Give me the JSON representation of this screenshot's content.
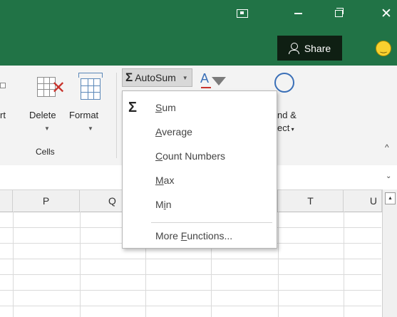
{
  "titlebar": {
    "share_label": "Share",
    "bg": "#217346"
  },
  "icons": {
    "ribbon_display": "ribbon-display-options-icon",
    "minimize": "minimize-icon",
    "restore": "restore-icon",
    "close": "close-icon",
    "share": "person-icon",
    "feedback": "smiley-icon"
  },
  "ribbon": {
    "insert_label_partial": "rt",
    "delete_label": "Delete",
    "format_label": "Format",
    "cells_group_label": "Cells",
    "autosum_label": "AutoSum",
    "find_select_line1": "nd &",
    "find_select_line2": "ect"
  },
  "autosum_menu": {
    "items": [
      {
        "label": "Sum",
        "key": "S"
      },
      {
        "label": "Average",
        "key": "A"
      },
      {
        "label": "Count Numbers",
        "key": "C"
      },
      {
        "label": "Max",
        "key": "M"
      },
      {
        "label": "Min",
        "key": "i"
      },
      {
        "label": "More Functions...",
        "key": "F"
      }
    ]
  },
  "columns": [
    "P",
    "Q",
    "",
    "",
    "T",
    "U"
  ]
}
